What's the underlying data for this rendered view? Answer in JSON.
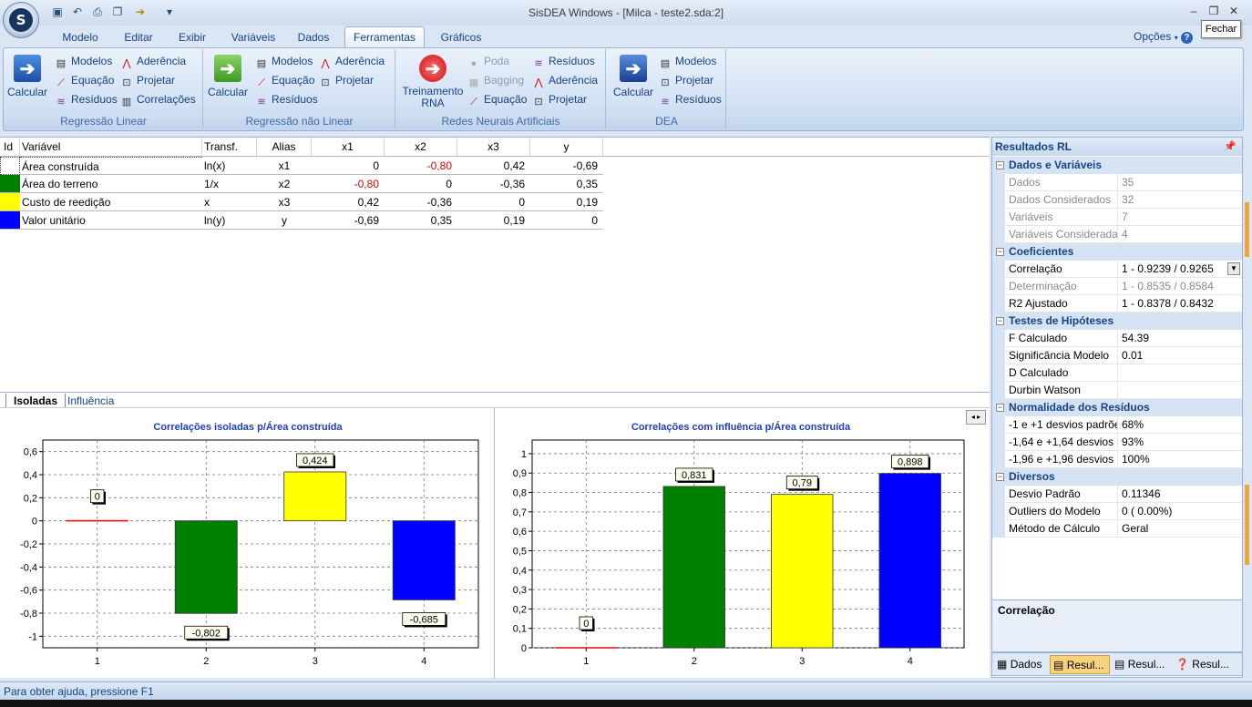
{
  "window": {
    "title": "SisDEA Windows - [Milca - teste2.sda:2]",
    "close_tooltip": "Fechar"
  },
  "menu": {
    "tabs": [
      "Modelo",
      "Editar",
      "Exibir",
      "Variáveis",
      "Dados",
      "Ferramentas",
      "Gráficos"
    ],
    "active_tab": "Ferramentas",
    "options": "Opções"
  },
  "ribbon": {
    "groups": [
      {
        "title": "Regressão Linear",
        "big": "Calcular",
        "items": [
          "Modelos",
          "Equação",
          "Resíduos",
          "Aderência",
          "Projetar",
          "Correlações"
        ]
      },
      {
        "title": "Regressão não Linear",
        "big": "Calcular",
        "items": [
          "Modelos",
          "Equação",
          "Resíduos",
          "Aderência",
          "Projetar"
        ]
      },
      {
        "title": "Redes Neurais Artificiais",
        "big": "Treinamento RNA",
        "items": [
          "Poda",
          "Bagging",
          "Equação",
          "Resíduos",
          "Aderência",
          "Projetar"
        ]
      },
      {
        "title": "DEA",
        "big": "Calcular",
        "items": [
          "Modelos",
          "Projetar",
          "Resíduos"
        ]
      }
    ]
  },
  "table": {
    "columns": [
      "Id",
      "Variável",
      "Transf.",
      "Alias",
      "x1",
      "x2",
      "x3",
      "y"
    ],
    "rows": [
      {
        "color": "#ffffff",
        "variable": "Área construída",
        "transf": "ln(x)",
        "alias": "x1",
        "x1": "0",
        "x2": "-0,80",
        "x3": "0,42",
        "y": "-0,69"
      },
      {
        "color": "#008000",
        "variable": "Área do terreno",
        "transf": "1/x",
        "alias": "x2",
        "x1": "-0,80",
        "x2": "0",
        "x3": "-0,36",
        "y": "0,35"
      },
      {
        "color": "#ffff00",
        "variable": "Custo de reedição",
        "transf": "x",
        "alias": "x3",
        "x1": "0,42",
        "x2": "-0,36",
        "x3": "0",
        "y": "0,19"
      },
      {
        "color": "#0000ff",
        "variable": "Valor unitário",
        "transf": "ln(y)",
        "alias": "y",
        "x1": "-0,69",
        "x2": "0,35",
        "x3": "0,19",
        "y": "0"
      }
    ]
  },
  "chart_tabs": [
    "Isoladas",
    "Influência"
  ],
  "chart_data": [
    {
      "type": "bar",
      "title": "Correlações isoladas p/Área construída",
      "categories": [
        "1",
        "2",
        "3",
        "4"
      ],
      "values": [
        0,
        -0.802,
        0.424,
        -0.685
      ],
      "labels": [
        "0",
        "-0,802",
        "0,424",
        "-0,685"
      ],
      "colors": [
        "#ff0000",
        "#008000",
        "#ffff00",
        "#0000ff"
      ],
      "ylim": [
        -1.1,
        0.7
      ],
      "yticks": [
        "0,6",
        "0,4",
        "0,2",
        "0",
        "-0,2",
        "-0,4",
        "-0,6",
        "-0,8",
        "-1"
      ],
      "grid": true
    },
    {
      "type": "bar",
      "title": "Correlações com influência p/Área construída",
      "categories": [
        "1",
        "2",
        "3",
        "4"
      ],
      "values": [
        0,
        0.831,
        0.79,
        0.898
      ],
      "labels": [
        "0",
        "0,831",
        "0,79",
        "0,898"
      ],
      "colors": [
        "#ff0000",
        "#008000",
        "#ffff00",
        "#0000ff"
      ],
      "ylim": [
        0,
        1.07
      ],
      "yticks": [
        "1",
        "0,9",
        "0,8",
        "0,7",
        "0,6",
        "0,5",
        "0,4",
        "0,3",
        "0,2",
        "0,1",
        "0"
      ],
      "grid": true
    }
  ],
  "panel": {
    "title": "Resultados RL",
    "categories": [
      {
        "name": "Dados e Variáveis",
        "rows": [
          [
            "Dados",
            "35"
          ],
          [
            "Dados Considerados",
            "32"
          ],
          [
            "Variáveis",
            "7"
          ],
          [
            "Variáveis Consideradas",
            "4"
          ]
        ]
      },
      {
        "name": "Coeficientes",
        "rows": [
          [
            "Correlação",
            "1 - 0.9239 / 0.9265"
          ],
          [
            "Determinação",
            "1 - 0.8535 / 0.8584"
          ],
          [
            "R2 Ajustado",
            "1 - 0.8378 / 0.8432"
          ]
        ]
      },
      {
        "name": "Testes de Hipóteses",
        "rows": [
          [
            "F Calculado",
            "54.39"
          ],
          [
            "Significância Modelo",
            "0.01"
          ],
          [
            "D Calculado",
            ""
          ],
          [
            "Durbin Watson",
            ""
          ]
        ]
      },
      {
        "name": "Normalidade dos Resíduos",
        "rows": [
          [
            "-1 e +1 desvios padrõe",
            "68%"
          ],
          [
            "-1,64 e +1,64 desvios p",
            "93%"
          ],
          [
            "-1,96 e +1,96 desvios p",
            "100%"
          ]
        ]
      },
      {
        "name": "Diversos",
        "rows": [
          [
            "Desvio Padrão",
            "0.11346"
          ],
          [
            "Outliers do Modelo",
            "0   ( 0.00%)"
          ],
          [
            "Método de Cálculo",
            "Geral"
          ]
        ]
      }
    ],
    "description": "Correlação",
    "bottom_tabs": [
      "Dados",
      "Resul...",
      "Resul...",
      "Resul..."
    ]
  },
  "status": "Para obter ajuda, pressione F1"
}
